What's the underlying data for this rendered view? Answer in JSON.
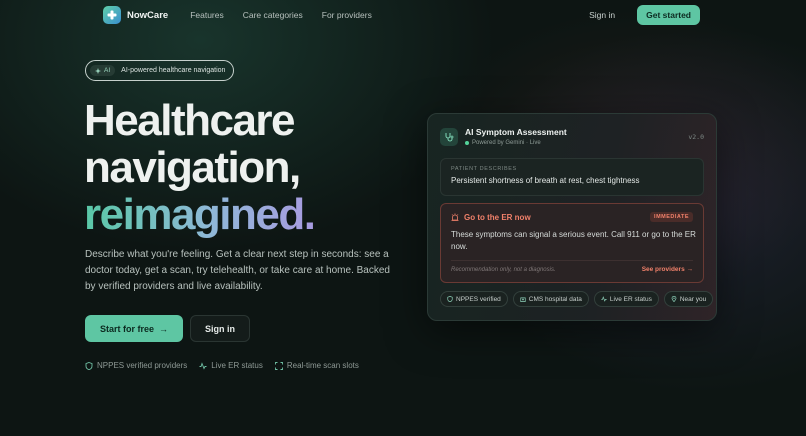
{
  "nav": {
    "brand": "NowCare",
    "links": [
      "Features",
      "Care categories",
      "For providers"
    ],
    "signin": "Sign in",
    "cta": "Get started"
  },
  "hero": {
    "pill_badge": "AI",
    "pill_text": "AI-powered healthcare navigation",
    "headline_1": "Healthcare",
    "headline_2": "navigation,",
    "headline_3": "reimagined.",
    "description": "Describe what you're feeling. Get a clear next step in seconds: see a doctor today, get a scan, try telehealth, or take care at home. Backed by verified providers and live availability.",
    "primary_button": "Start for free",
    "secondary_button": "Sign in",
    "trust": [
      "NPPES verified providers",
      "Live ER status",
      "Real-time scan slots"
    ]
  },
  "card": {
    "title": "AI Symptom Assessment",
    "subtitle": "Powered by Gemini · Live",
    "version": "v2.0",
    "patient_label": "PATIENT DESCRIBES",
    "patient_text": "Persistent shortness of breath at rest, chest tightness",
    "er_title": "Go to the ER now",
    "er_badge": "IMMEDIATE",
    "er_text": "These symptoms can signal a serious event. Call 911 or go to the ER now.",
    "er_note": "Recommendation only, not a diagnosis.",
    "er_link": "See providers",
    "chips": [
      "NPPES verified",
      "CMS hospital data",
      "Live ER status",
      "Near you"
    ]
  },
  "colors": {
    "accent": "#5ec6a3",
    "danger": "#f0806a",
    "background": "#0d1513"
  }
}
